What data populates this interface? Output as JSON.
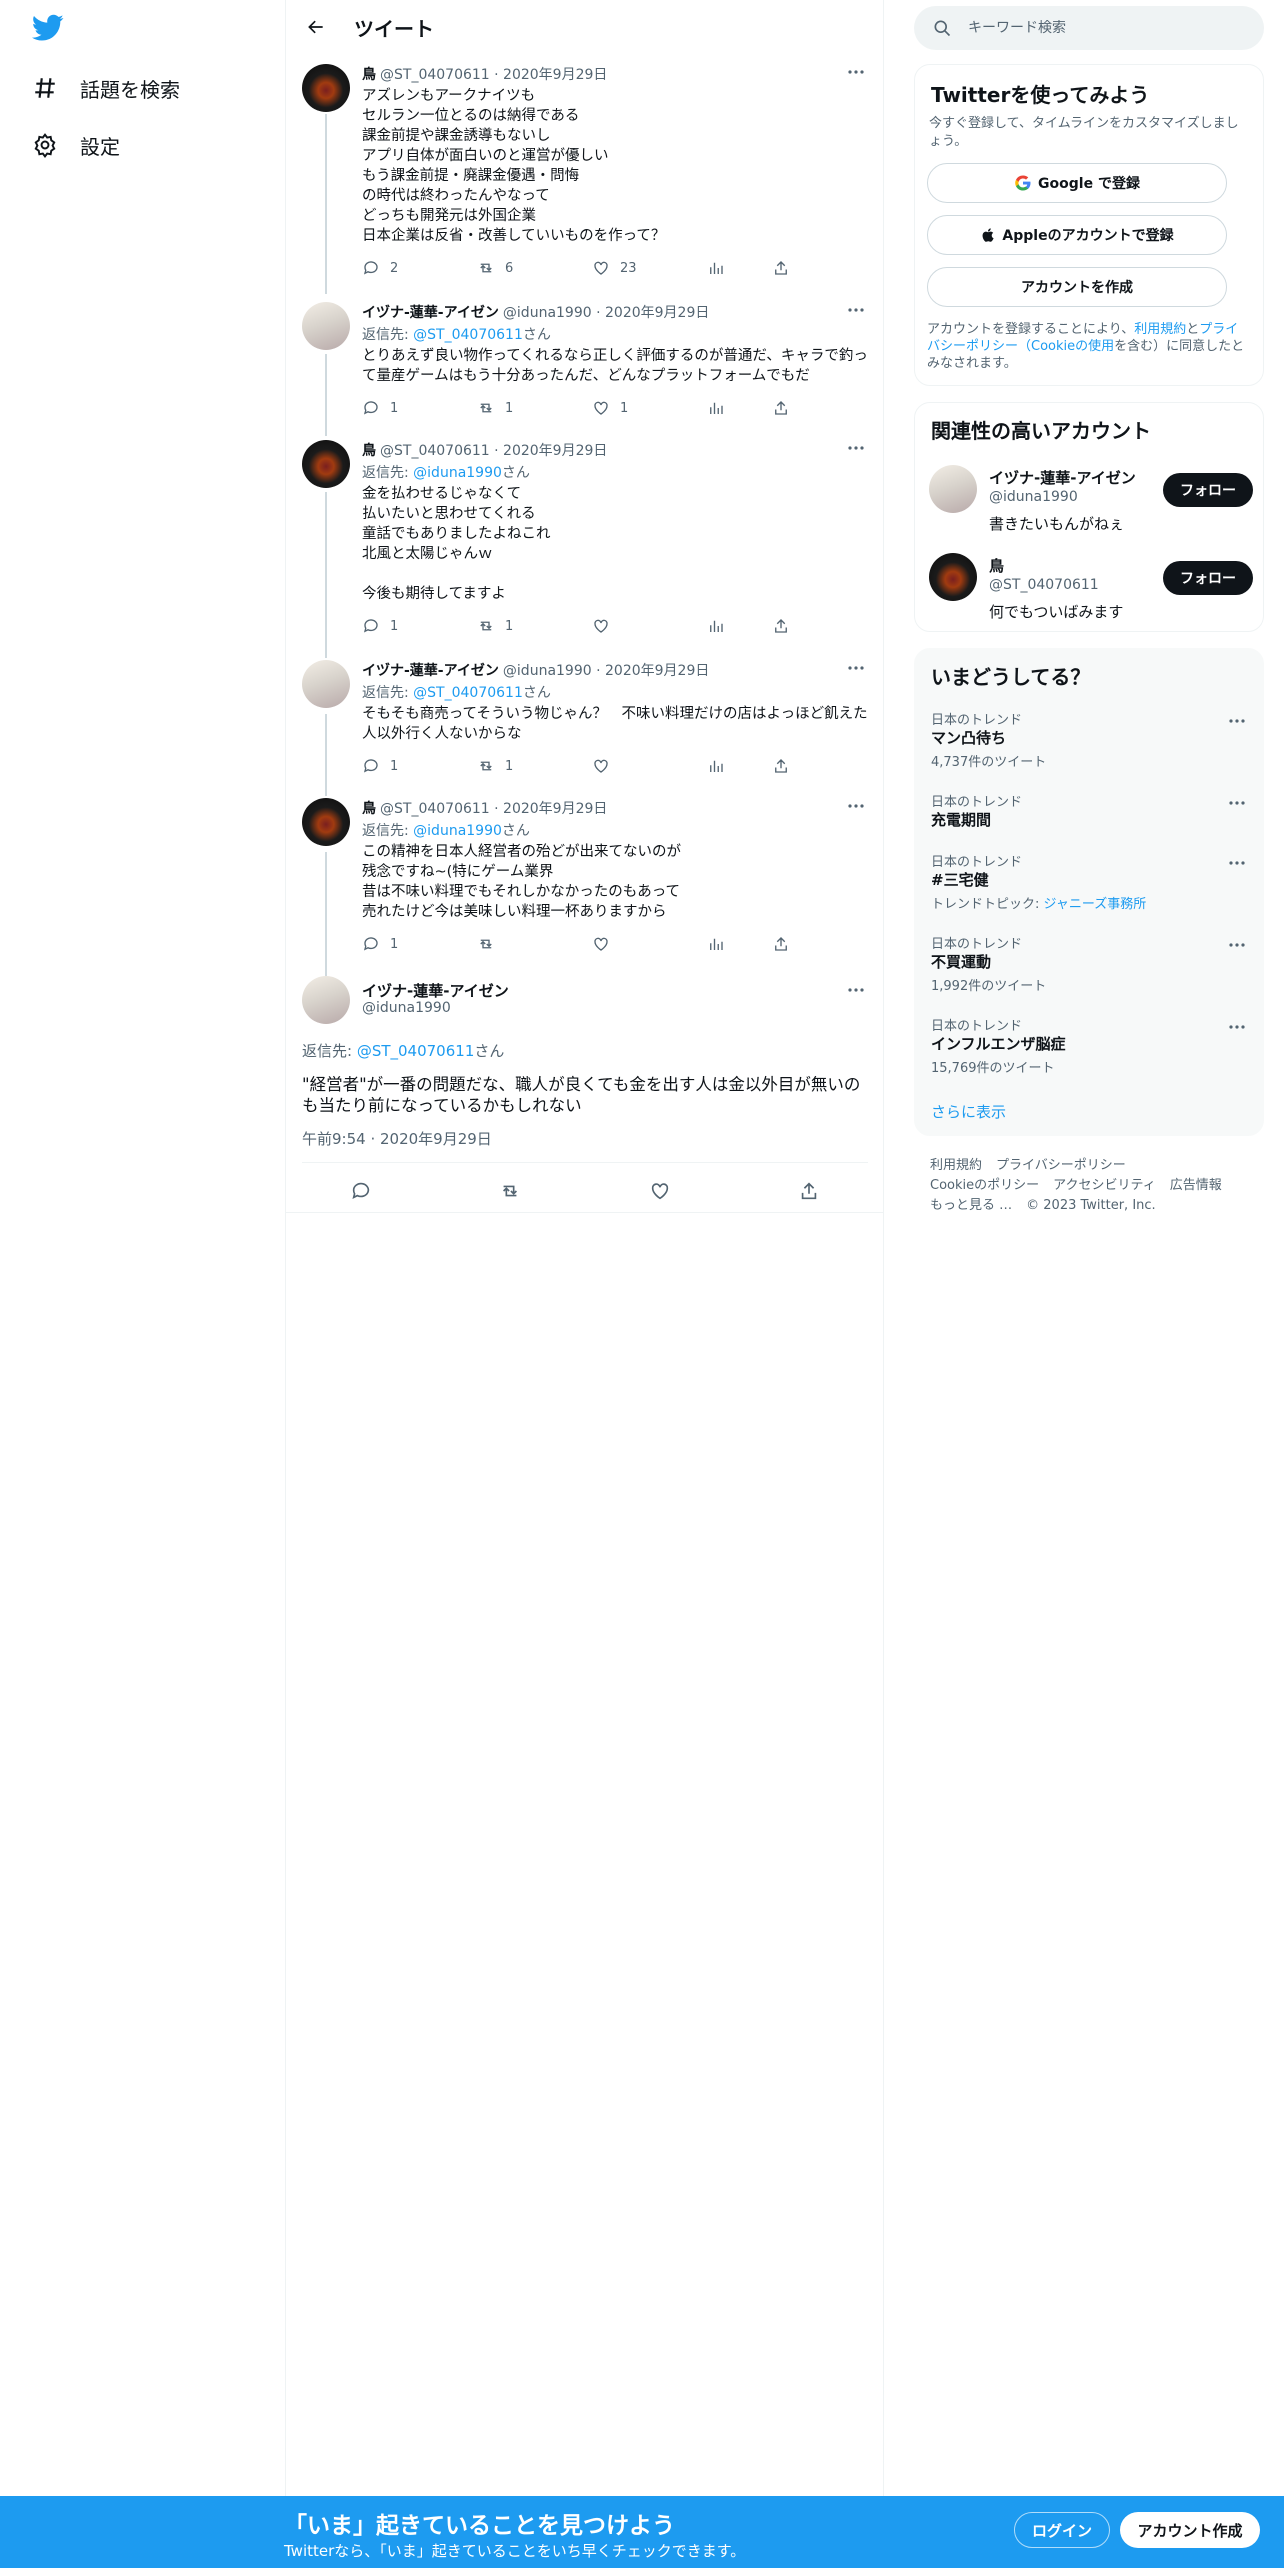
{
  "colors": {
    "accent": "#1d9bf0",
    "text": "#0f1419",
    "muted": "#536471"
  },
  "nav": {
    "items": [
      {
        "label": "話題を検索",
        "icon": "hashtag-icon"
      },
      {
        "label": "設定",
        "icon": "gear-icon"
      }
    ]
  },
  "header": {
    "title": "ツイート"
  },
  "thread": [
    {
      "name": "鳥",
      "meta": "@ST_04070611 · 2020年9月29日",
      "reply_prefix": "",
      "reply_mention": "",
      "reply_suffix": "",
      "text": "アズレンもアークナイツも\nセルラン一位とるのは納得である\n課金前提や課金誘導もないし\nアプリ自体が面白いのと運営が優しい\nもう課金前提・廃課金優遇・問悔\nの時代は終わったんやなって\nどっちも開発元は外国企業\n日本企業は反省・改善していいものを作って？",
      "reply_count": "2",
      "retweet_count": "6",
      "like_count": "23"
    },
    {
      "name": "イヅナ-蓮華-アイゼン",
      "meta": "@iduna1990 · 2020年9月29日",
      "reply_prefix": "返信先: ",
      "reply_mention": "@ST_04070611",
      "reply_suffix": "さん",
      "text": "とりあえず良い物作ってくれるなら正しく評価するのが普通だ、キャラで釣って量産ゲームはもう十分あったんだ、どんなプラットフォームでもだ",
      "reply_count": "1",
      "retweet_count": "1",
      "like_count": "1"
    },
    {
      "name": "鳥",
      "meta": "@ST_04070611 · 2020年9月29日",
      "reply_prefix": "返信先: ",
      "reply_mention": "@iduna1990",
      "reply_suffix": "さん",
      "text": "金を払わせるじゃなくて\n払いたいと思わせてくれる\n童話でもありましたよねこれ\n北風と太陽じゃんｗ\n\n今後も期待してますよ",
      "reply_count": "1",
      "retweet_count": "1",
      "like_count": ""
    },
    {
      "name": "イヅナ-蓮華-アイゼン",
      "meta": "@iduna1990 · 2020年9月29日",
      "reply_prefix": "返信先: ",
      "reply_mention": "@ST_04070611",
      "reply_suffix": "さん",
      "text": "そもそも商売ってそういう物じゃん？　不味い料理だけの店はよっほど飢えた人以外行く人ないからな",
      "reply_count": "1",
      "retweet_count": "1",
      "like_count": ""
    },
    {
      "name": "鳥",
      "meta": "@ST_04070611 · 2020年9月29日",
      "reply_prefix": "返信先: ",
      "reply_mention": "@iduna1990",
      "reply_suffix": "さん",
      "text": "この精神を日本人経営者の殆どが出来てないのが\n残念ですね~(特にゲーム業界\n昔は不味い料理でもそれしかなかったのもあって\n売れたけど今は美味しい料理一杯ありますから",
      "reply_count": "1",
      "retweet_count": "",
      "like_count": ""
    }
  ],
  "focus": {
    "name": "イヅナ-蓮華-アイゼン",
    "handle": "@iduna1990",
    "reply_prefix": "返信先: ",
    "reply_mention": "@ST_04070611",
    "reply_suffix": "さん",
    "text": "\"経営者\"が一番の問題だな、職人が良くても金を出す人は金以外目が無いのも当たり前になっているかもしれない",
    "time": "午前9:54 · 2020年9月29日"
  },
  "search": {
    "placeholder": "キーワード検索"
  },
  "signup": {
    "title": "Twitterを使ってみよう",
    "subtitle": "今すぐ登録して、タイムラインをカスタマイズしましょう。",
    "google": "Google で登録",
    "apple": "Appleのアカウントで登録",
    "create": "アカウントを作成",
    "terms_pre": "アカウントを登録することにより、",
    "terms_link1": "利用規約",
    "terms_mid": "と",
    "terms_link2": "プライバシーポリシー（Cookieの使用",
    "terms_post": "を含む）に同意したとみなされます。"
  },
  "related": {
    "title": "関連性の高いアカウント",
    "accounts": [
      {
        "name": "イヅナ-蓮華-アイゼン",
        "handle": "@iduna1990",
        "bio": "書きたいもんがねぇ",
        "follow": "フォロー"
      },
      {
        "name": "鳥",
        "handle": "@ST_04070611",
        "bio": "何でもついばみます",
        "follow": "フォロー"
      }
    ]
  },
  "trends": {
    "title": "いまどうしてる？",
    "items": [
      {
        "label": "日本のトレンド",
        "name": "マン凸待ち",
        "count": "4,737件のツイート",
        "topic_prefix": "",
        "topic_link": ""
      },
      {
        "label": "日本のトレンド",
        "name": "充電期間",
        "count": "",
        "topic_prefix": "",
        "topic_link": ""
      },
      {
        "label": "日本のトレンド",
        "name": "#三宅健",
        "count": "",
        "topic_prefix": "トレンドトピック: ",
        "topic_link": "ジャニーズ事務所"
      },
      {
        "label": "日本のトレンド",
        "name": "不買運動",
        "count": "1,992件のツイート",
        "topic_prefix": "",
        "topic_link": ""
      },
      {
        "label": "日本のトレンド",
        "name": "インフルエンザ脳症",
        "count": "15,769件のツイート",
        "topic_prefix": "",
        "topic_link": ""
      }
    ],
    "show_more": "さらに表示"
  },
  "footer": {
    "links": [
      "利用規約",
      "プライバシーポリシー",
      "Cookieのポリシー",
      "アクセシビリティ",
      "広告情報",
      "もっと見る …"
    ],
    "copyright": "© 2023 Twitter, Inc."
  },
  "bottom_bar": {
    "title": "「いま」起きていることを見つけよう",
    "subtitle": "Twitterなら、「いま」起きていることをいち早くチェックできます。",
    "login": "ログイン",
    "signup": "アカウント作成"
  }
}
